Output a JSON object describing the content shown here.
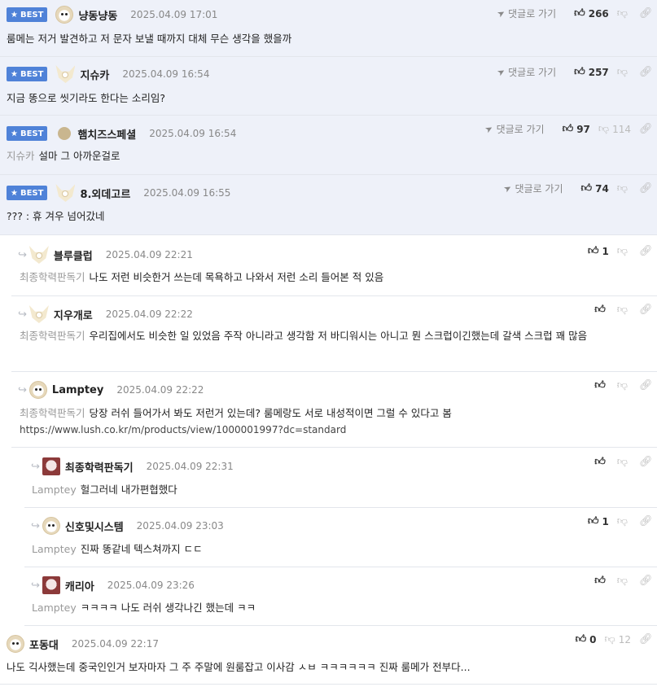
{
  "ui": {
    "best_label": "BEST",
    "reply_to_label": "댓글로 가기"
  },
  "comments": [
    {
      "nick": "냥동냥동",
      "date": "2025.04.09 17:01",
      "text": "룸메는 저거 발견하고 저 문자 보낼 때까지 대체 무슨 생각을 했을까",
      "up": "266",
      "down": "",
      "mention": ""
    },
    {
      "nick": "지슈카",
      "date": "2025.04.09 16:54",
      "text": "지금 똥으로 씻기라도 한다는 소리임?",
      "up": "257",
      "down": "",
      "mention": ""
    },
    {
      "nick": "햄치즈스페셜",
      "date": "2025.04.09 16:54",
      "text": "설마 그 아까운걸로",
      "up": "97",
      "down": "114",
      "mention": "지슈카"
    },
    {
      "nick": "8.외데고르",
      "date": "2025.04.09 16:55",
      "text": "??? : 휴 겨우 넘어갔네",
      "up": "74",
      "down": "",
      "mention": ""
    },
    {
      "nick": "블루클럽",
      "date": "2025.04.09 22:21",
      "text": "나도 저런 비슷한거 쓰는데 목욕하고 나와서 저런 소리 들어본 적 있음",
      "up": "1",
      "down": "",
      "mention": "최종학력판독기"
    },
    {
      "nick": "지우개로",
      "date": "2025.04.09 22:22",
      "text": "우리집에서도 비슷한 일 있었음 주작 아니라고 생각함 저 바디워시는 아니고 뭔 스크럽이긴했는데 갈색 스크럽 꽤 많음",
      "up": "",
      "down": "",
      "mention": "최종학력판독기"
    },
    {
      "nick": "Lamptey",
      "date": "2025.04.09 22:22",
      "text": "당장 러쉬 들어가서 봐도 저런거 있는데? 룸메랑도 서로 내성적이면 그럴 수 있다고 봄",
      "url": "https://www.lush.co.kr/m/products/view/1000001997?dc=standard",
      "up": "",
      "down": "",
      "mention": "최종학력판독기"
    },
    {
      "nick": "최종학력판독기",
      "date": "2025.04.09 22:31",
      "text": "헐그러네 내가편협했다",
      "up": "",
      "down": "",
      "mention": "Lamptey"
    },
    {
      "nick": "신호및시스템",
      "date": "2025.04.09 23:03",
      "text": "진짜 똥같네 텍스쳐까지 ㄷㄷ",
      "up": "1",
      "down": "",
      "mention": "Lamptey"
    },
    {
      "nick": "캐리아",
      "date": "2025.04.09 23:26",
      "text": "ㅋㅋㅋㅋ 나도 러쉬 생각나긴 했는데 ㅋㅋ",
      "up": "",
      "down": "",
      "mention": "Lamptey"
    },
    {
      "nick": "포동대",
      "date": "2025.04.09 22:17",
      "text": "나도 긱사했는데 중국인인거 보자마자 그 주 주말에 원룸잡고 이사감 ㅅㅂ ㅋㅋㅋㅋㅋㅋ 진짜 룸메가 전부다...",
      "up": "0",
      "down": "12",
      "mention": ""
    }
  ]
}
